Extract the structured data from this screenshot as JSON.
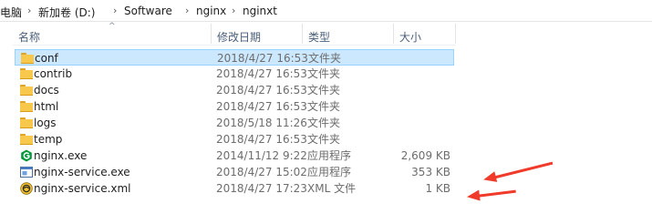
{
  "breadcrumb": {
    "items": [
      "电脑",
      "新加卷 (D:)",
      "Software",
      "nginx",
      "nginxt"
    ],
    "separator": "›"
  },
  "columns": {
    "name": "名称",
    "date": "修改日期",
    "type": "类型",
    "size": "大小"
  },
  "files": [
    {
      "name": "conf",
      "date": "2018/4/27 16:53",
      "type": "文件夹",
      "size": "",
      "icon": "folder-icon",
      "selected": true
    },
    {
      "name": "contrib",
      "date": "2018/4/27 16:53",
      "type": "文件夹",
      "size": "",
      "icon": "folder-icon",
      "selected": false
    },
    {
      "name": "docs",
      "date": "2018/4/27 16:53",
      "type": "文件夹",
      "size": "",
      "icon": "folder-icon",
      "selected": false
    },
    {
      "name": "html",
      "date": "2018/4/27 16:53",
      "type": "文件夹",
      "size": "",
      "icon": "folder-icon",
      "selected": false
    },
    {
      "name": "logs",
      "date": "2018/5/18 11:26",
      "type": "文件夹",
      "size": "",
      "icon": "folder-icon",
      "selected": false
    },
    {
      "name": "temp",
      "date": "2018/4/27 16:53",
      "type": "文件夹",
      "size": "",
      "icon": "folder-icon",
      "selected": false
    },
    {
      "name": "nginx.exe",
      "date": "2014/11/12 9:22",
      "type": "应用程序",
      "size": "2,609 KB",
      "icon": "nginx-exe-icon",
      "selected": false
    },
    {
      "name": "nginx-service.exe",
      "date": "2018/4/27 15:02",
      "type": "应用程序",
      "size": "353 KB",
      "icon": "application-icon",
      "selected": false
    },
    {
      "name": "nginx-service.xml",
      "date": "2018/4/27 17:23",
      "type": "XML 文件",
      "size": "1 KB",
      "icon": "xml-file-icon",
      "selected": false
    }
  ],
  "colors": {
    "selection_bg": "#cce8ff",
    "selection_border": "#99d1ff",
    "header_text": "#4c607a",
    "annotation_arrow": "#f03a2a"
  }
}
